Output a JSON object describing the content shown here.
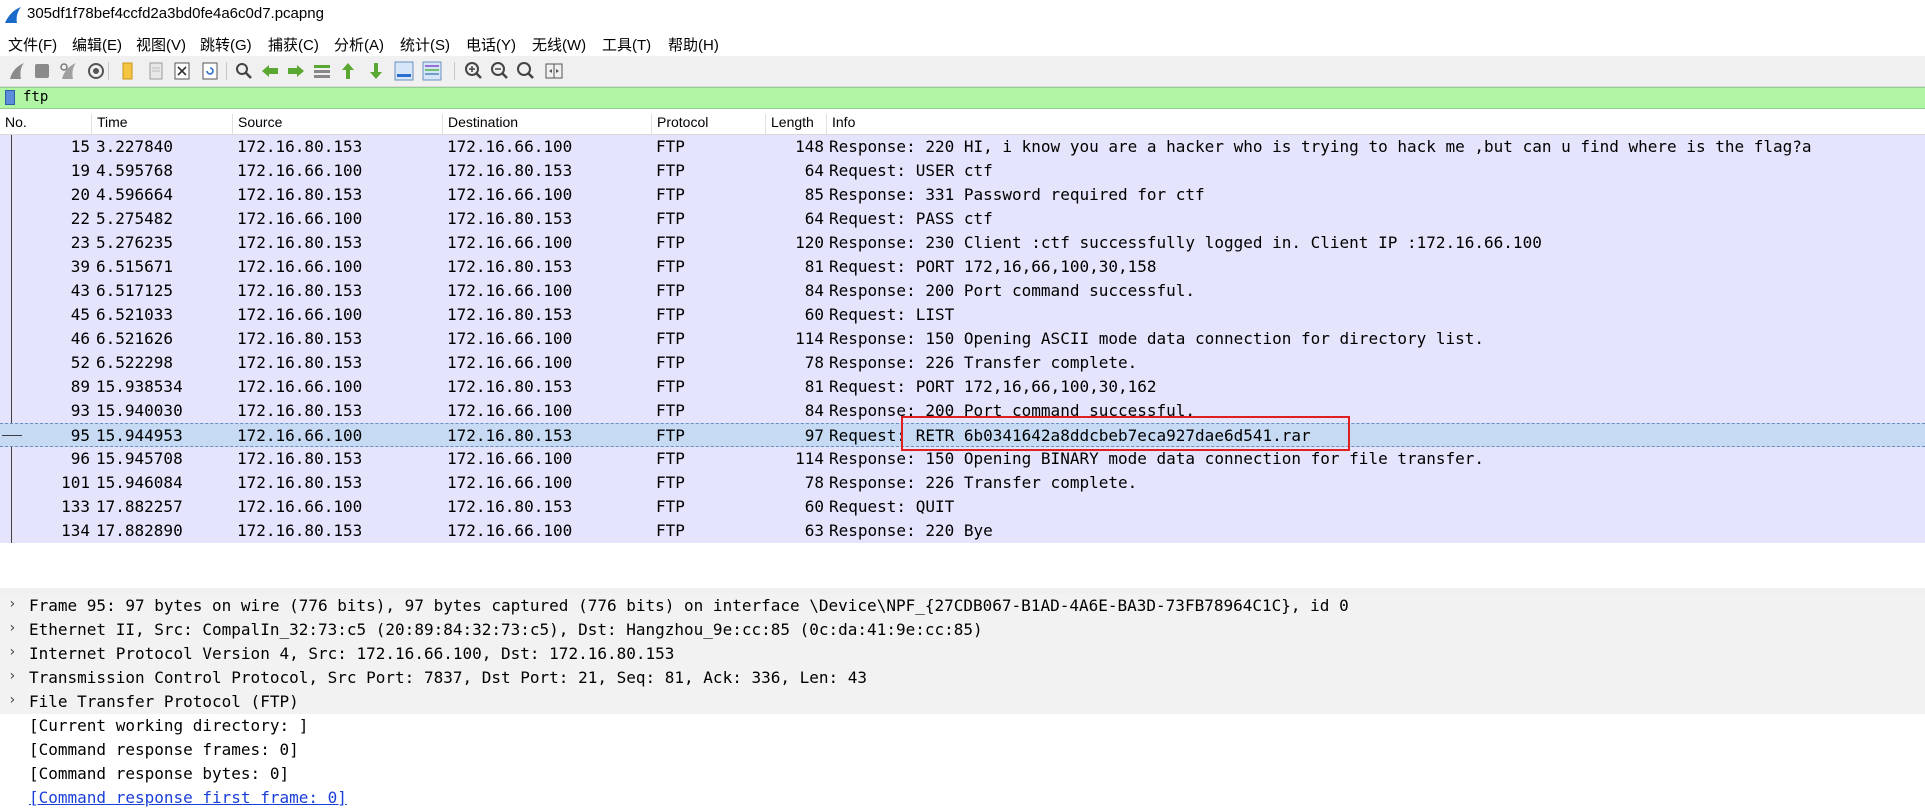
{
  "window": {
    "title": "305df1f78bef4ccfd2a3bd0fe4a6c0d7.pcapng"
  },
  "menu": [
    "文件(F)",
    "编辑(E)",
    "视图(V)",
    "跳转(G)",
    "捕获(C)",
    "分析(A)",
    "统计(S)",
    "电话(Y)",
    "无线(W)",
    "工具(T)",
    "帮助(H)"
  ],
  "toolbar": {
    "icons": [
      "start-capture-icon",
      "stop-capture-icon",
      "restart-capture-icon",
      "capture-options-icon",
      "open-file-icon",
      "save-file-icon",
      "close-file-icon",
      "reload-file-icon",
      "find-packet-icon",
      "go-back-icon",
      "go-forward-icon",
      "go-to-packet-icon",
      "go-first-icon",
      "go-last-icon",
      "autoscroll-icon",
      "colorize-icon",
      "zoom-in-icon",
      "zoom-out-icon",
      "zoom-normal-icon",
      "resize-columns-icon"
    ]
  },
  "filter": {
    "value": "ftp"
  },
  "columns": {
    "no": "No.",
    "time": "Time",
    "source": "Source",
    "destination": "Destination",
    "protocol": "Protocol",
    "length": "Length",
    "info": "Info"
  },
  "packets": [
    {
      "no": "15",
      "time": "3.227840",
      "src": "172.16.80.153",
      "dst": "172.16.66.100",
      "proto": "FTP",
      "len": "148",
      "info": "Response: 220 HI, i know you are a hacker who is trying to hack me ,but can u find where is the flag?a"
    },
    {
      "no": "19",
      "time": "4.595768",
      "src": "172.16.66.100",
      "dst": "172.16.80.153",
      "proto": "FTP",
      "len": "64",
      "info": "Request: USER ctf"
    },
    {
      "no": "20",
      "time": "4.596664",
      "src": "172.16.80.153",
      "dst": "172.16.66.100",
      "proto": "FTP",
      "len": "85",
      "info": "Response: 331 Password required for ctf"
    },
    {
      "no": "22",
      "time": "5.275482",
      "src": "172.16.66.100",
      "dst": "172.16.80.153",
      "proto": "FTP",
      "len": "64",
      "info": "Request: PASS ctf"
    },
    {
      "no": "23",
      "time": "5.276235",
      "src": "172.16.80.153",
      "dst": "172.16.66.100",
      "proto": "FTP",
      "len": "120",
      "info": "Response: 230 Client :ctf successfully logged in. Client IP :172.16.66.100"
    },
    {
      "no": "39",
      "time": "6.515671",
      "src": "172.16.66.100",
      "dst": "172.16.80.153",
      "proto": "FTP",
      "len": "81",
      "info": "Request: PORT 172,16,66,100,30,158"
    },
    {
      "no": "43",
      "time": "6.517125",
      "src": "172.16.80.153",
      "dst": "172.16.66.100",
      "proto": "FTP",
      "len": "84",
      "info": "Response: 200 Port command successful."
    },
    {
      "no": "45",
      "time": "6.521033",
      "src": "172.16.66.100",
      "dst": "172.16.80.153",
      "proto": "FTP",
      "len": "60",
      "info": "Request: LIST"
    },
    {
      "no": "46",
      "time": "6.521626",
      "src": "172.16.80.153",
      "dst": "172.16.66.100",
      "proto": "FTP",
      "len": "114",
      "info": "Response: 150 Opening ASCII mode data connection for directory list."
    },
    {
      "no": "52",
      "time": "6.522298",
      "src": "172.16.80.153",
      "dst": "172.16.66.100",
      "proto": "FTP",
      "len": "78",
      "info": "Response: 226 Transfer complete."
    },
    {
      "no": "89",
      "time": "15.938534",
      "src": "172.16.66.100",
      "dst": "172.16.80.153",
      "proto": "FTP",
      "len": "81",
      "info": "Request: PORT 172,16,66,100,30,162"
    },
    {
      "no": "93",
      "time": "15.940030",
      "src": "172.16.80.153",
      "dst": "172.16.66.100",
      "proto": "FTP",
      "len": "84",
      "info": "Response: 200 Port command successful."
    },
    {
      "no": "95",
      "time": "15.944953",
      "src": "172.16.66.100",
      "dst": "172.16.80.153",
      "proto": "FTP",
      "len": "97",
      "info": "Request: RETR 6b0341642a8ddcbeb7eca927dae6d541.rar",
      "selected": true
    },
    {
      "no": "96",
      "time": "15.945708",
      "src": "172.16.80.153",
      "dst": "172.16.66.100",
      "proto": "FTP",
      "len": "114",
      "info": "Response: 150 Opening BINARY mode data connection for file transfer."
    },
    {
      "no": "101",
      "time": "15.946084",
      "src": "172.16.80.153",
      "dst": "172.16.66.100",
      "proto": "FTP",
      "len": "78",
      "info": "Response: 226 Transfer complete."
    },
    {
      "no": "133",
      "time": "17.882257",
      "src": "172.16.66.100",
      "dst": "172.16.80.153",
      "proto": "FTP",
      "len": "60",
      "info": "Request: QUIT"
    },
    {
      "no": "134",
      "time": "17.882890",
      "src": "172.16.80.153",
      "dst": "172.16.66.100",
      "proto": "FTP",
      "len": "63",
      "info": "Response: 220 Bye"
    }
  ],
  "details": [
    {
      "text": "Frame 95: 97 bytes on wire (776 bits), 97 bytes captured (776 bits) on interface \\Device\\NPF_{27CDB067-B1AD-4A6E-BA3D-73FB78964C1C}, id 0",
      "expandable": true
    },
    {
      "text": "Ethernet II, Src: CompalIn_32:73:c5 (20:89:84:32:73:c5), Dst: Hangzhou_9e:cc:85 (0c:da:41:9e:cc:85)",
      "expandable": true
    },
    {
      "text": "Internet Protocol Version 4, Src: 172.16.66.100, Dst: 172.16.80.153",
      "expandable": true
    },
    {
      "text": "Transmission Control Protocol, Src Port: 7837, Dst Port: 21, Seq: 81, Ack: 336, Len: 43",
      "expandable": true
    },
    {
      "text": "File Transfer Protocol (FTP)",
      "expandable": true
    },
    {
      "text": "[Current working directory: ]",
      "expandable": false
    },
    {
      "text": "[Command response frames: 0]",
      "expandable": false
    },
    {
      "text": "[Command response bytes: 0]",
      "expandable": false
    },
    {
      "text": "[Command response first frame: 0]",
      "expandable": false,
      "link": true
    }
  ],
  "colors": {
    "row_bg": "#e4e4fc",
    "selected_bg": "#c6daf3",
    "filter_bg": "#aff5a3",
    "highlight_box": "#e02020"
  }
}
